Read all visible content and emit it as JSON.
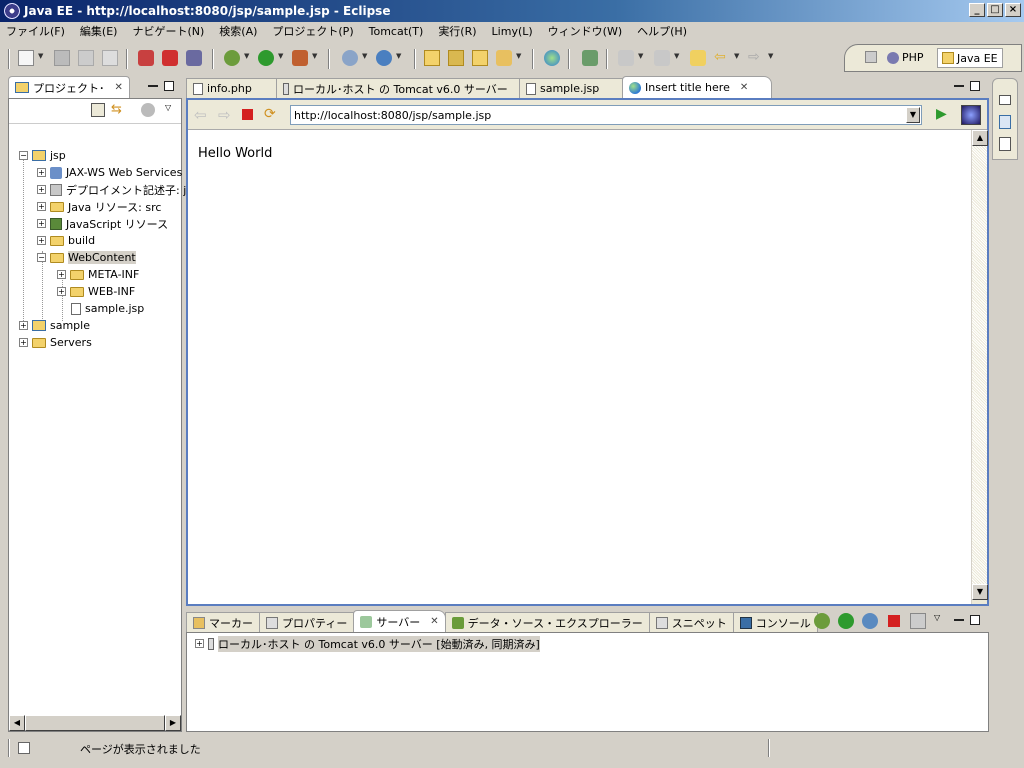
{
  "window": {
    "title": "Java EE - http://localhost:8080/jsp/sample.jsp - Eclipse"
  },
  "menu": [
    "ファイル(F)",
    "編集(E)",
    "ナビゲート(N)",
    "検索(A)",
    "プロジェクト(P)",
    "Tomcat(T)",
    "実行(R)",
    "Limy(L)",
    "ウィンドウ(W)",
    "ヘルプ(H)"
  ],
  "perspectives": {
    "php": "PHP",
    "javaee": "Java EE"
  },
  "project_explorer": {
    "tab_label": "プロジェクト･",
    "tree": {
      "jsp": "jsp",
      "jaxws": "JAX-WS Web Services",
      "deploy": "デプロイメント記述子: j",
      "java_res": "Java リソース: src",
      "js_res": "JavaScript リソース",
      "build": "build",
      "webcontent": "WebContent",
      "metainf": "META-INF",
      "webinf": "WEB-INF",
      "samplejsp": "sample.jsp",
      "sample": "sample",
      "servers": "Servers"
    }
  },
  "editor": {
    "tabs": [
      "info.php",
      "ローカル･ホスト の Tomcat v6.0 サーバー",
      "sample.jsp",
      "Insert title here"
    ],
    "url": "http://localhost:8080/jsp/sample.jsp",
    "page_content": "Hello World"
  },
  "bottom": {
    "tabs": [
      "マーカー",
      "プロパティー",
      "サーバー",
      "データ・ソース・エクスプローラー",
      "スニペット",
      "コンソール"
    ],
    "server_entry": "ローカル･ホスト の Tomcat v6.0 サーバー  [始動済み, 同期済み]"
  },
  "status": {
    "message": "ページが表示されました"
  }
}
